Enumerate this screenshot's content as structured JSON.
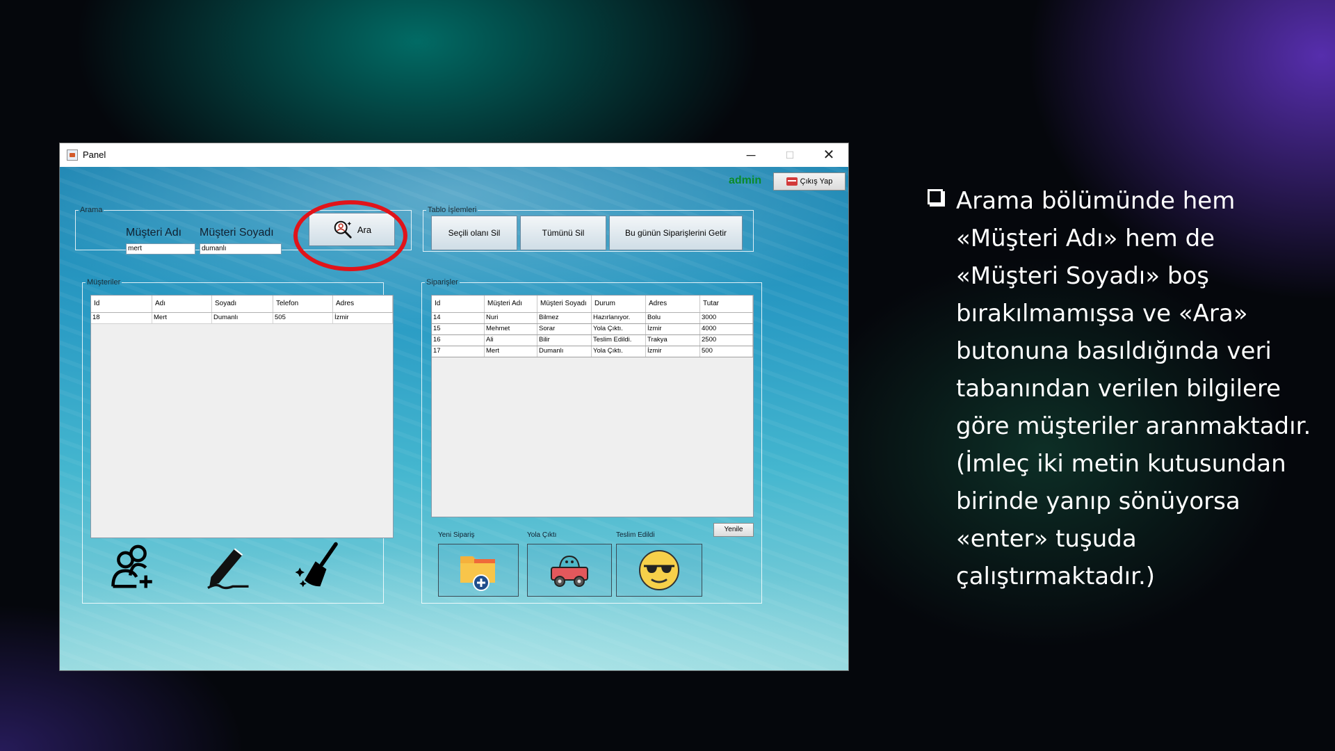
{
  "window": {
    "title": "Panel",
    "controls": {
      "minimize": "─",
      "maximize": "☐",
      "close": "✕"
    }
  },
  "header": {
    "user": "admin",
    "logout_label": "Çıkış Yap"
  },
  "search": {
    "legend": "Arama",
    "first_name_label": "Müşteri Adı",
    "last_name_label": "Müşteri Soyadı",
    "first_name_value": "mert",
    "last_name_value": "dumanlı",
    "button_label": "Ara"
  },
  "table_ops": {
    "legend": "Tablo İşlemleri",
    "delete_selected": "Seçili olanı Sil",
    "delete_all": "Tümünü Sil",
    "todays_orders": "Bu günün Siparişlerini Getir"
  },
  "customers": {
    "legend": "Müşteriler",
    "columns": [
      "Id",
      "Adı",
      "Soyadı",
      "Telefon",
      "Adres"
    ],
    "rows": [
      [
        "18",
        "Mert",
        "Dumanlı",
        "505",
        "İzmir"
      ]
    ]
  },
  "orders": {
    "legend": "Siparişler",
    "columns": [
      "Id",
      "Müşteri Adı",
      "Müşteri Soyadı",
      "Durum",
      "Adres",
      "Tutar"
    ],
    "rows": [
      [
        "14",
        "Nuri",
        "Bilmez",
        "Hazırlanıyor.",
        "Bolu",
        "3000"
      ],
      [
        "15",
        "Mehmet",
        "Sorar",
        "Yola Çıktı.",
        "İzmir",
        "4000"
      ],
      [
        "16",
        "Ali",
        "Bilir",
        "Teslim Edildi.",
        "Trakya",
        "2500"
      ],
      [
        "17",
        "Mert",
        "Dumanlı",
        "Yola Çıktı.",
        "İzmir",
        "500"
      ]
    ],
    "renew_label": "Yenile",
    "status_buttons": {
      "new_order": "Yeni Sipariş",
      "on_the_way": "Yola Çıktı",
      "delivered": "Teslim Edildi"
    }
  },
  "icons": {
    "customer_actions": [
      "add-user-icon",
      "edit-pencil-icon",
      "clean-broom-icon"
    ],
    "status": [
      "new-folder-icon",
      "delivery-car-icon",
      "sunglasses-smiley-icon"
    ]
  },
  "colors": {
    "admin": "#0a8a2a",
    "highlight_ring": "#e0141a",
    "accent": "#2a9bc4"
  },
  "explanation": {
    "text": "Arama bölümünde hem «Müşteri Adı» hem de «Müşteri Soyadı» boş bırakılmamışsa ve «Ara» butonuna basıldığında veri tabanından verilen bilgilere göre müşteriler aranmaktadır. (İmleç iki metin kutusundan birinde yanıp sönüyorsa «enter» tuşuda çalıştırmaktadır.)"
  }
}
